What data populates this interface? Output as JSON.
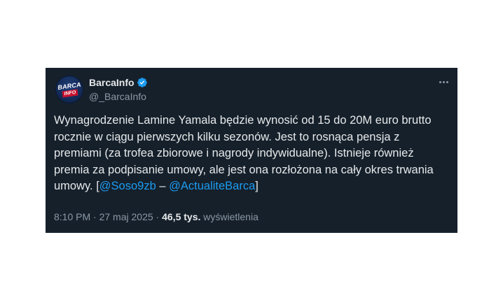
{
  "author": {
    "display_name": "BarcaInfo",
    "handle": "@_BarcaInfo",
    "avatar_text_top": "BARCA",
    "avatar_text_bottom": "INFO",
    "verified": true
  },
  "tweet": {
    "text_plain": "Wynagrodzenie Lamine Yamala będzie wynosić od 15 do 20M euro brutto rocznie w ciągu pierwszych kilku sezonów. Jest to rosnąca pensja z premiami (za trofea zbiorowe i nagrody indywidualne). Istnieje również premia za podpisanie umowy, ale jest ona rozłożona na cały okres trwania umowy. [",
    "mention_1": "@Soso9zb",
    "separator": " – ",
    "mention_2": "@ActualiteBarca",
    "text_end": "]"
  },
  "meta": {
    "time": "8:10 PM",
    "dot_1": " · ",
    "date": "27 maj 2025",
    "dot_2": " · ",
    "views_count": "46,5 tys.",
    "views_label": " wyświetlenia"
  },
  "colors": {
    "background": "#15202b",
    "text": "#e7e9ea",
    "secondary": "#8b98a5",
    "link": "#1d9bf0",
    "verified": "#1d9bf0"
  },
  "icons": {
    "verified": "verified-badge-icon",
    "more": "more-dots-icon"
  }
}
